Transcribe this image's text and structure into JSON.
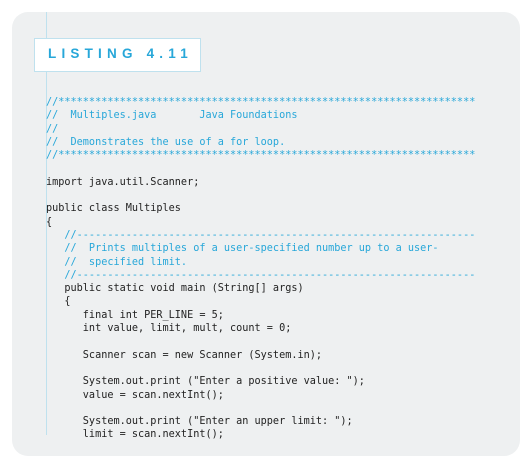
{
  "listing": {
    "title": "LISTING 4.11",
    "lines": [
      {
        "text": "//********************************************************************",
        "kind": "comment"
      },
      {
        "text": "//  Multiples.java       Java Foundations",
        "kind": "comment"
      },
      {
        "text": "//",
        "kind": "comment"
      },
      {
        "text": "//  Demonstrates the use of a for loop.",
        "kind": "comment"
      },
      {
        "text": "//********************************************************************",
        "kind": "comment"
      },
      {
        "text": "",
        "kind": "blank"
      },
      {
        "text": "import java.util.Scanner;",
        "kind": "code"
      },
      {
        "text": "",
        "kind": "blank"
      },
      {
        "text": "public class Multiples",
        "kind": "code"
      },
      {
        "text": "{",
        "kind": "code"
      },
      {
        "text": "   //-----------------------------------------------------------------",
        "kind": "comment"
      },
      {
        "text": "   //  Prints multiples of a user-specified number up to a user-",
        "kind": "comment"
      },
      {
        "text": "   //  specified limit.",
        "kind": "comment"
      },
      {
        "text": "   //-----------------------------------------------------------------",
        "kind": "comment"
      },
      {
        "text": "   public static void main (String[] args)",
        "kind": "code"
      },
      {
        "text": "   {",
        "kind": "code"
      },
      {
        "text": "      final int PER_LINE = 5;",
        "kind": "code"
      },
      {
        "text": "      int value, limit, mult, count = 0;",
        "kind": "code"
      },
      {
        "text": "",
        "kind": "blank"
      },
      {
        "text": "      Scanner scan = new Scanner (System.in);",
        "kind": "code"
      },
      {
        "text": "",
        "kind": "blank"
      },
      {
        "text": "      System.out.print (\"Enter a positive value: \");",
        "kind": "code"
      },
      {
        "text": "      value = scan.nextInt();",
        "kind": "code"
      },
      {
        "text": "",
        "kind": "blank"
      },
      {
        "text": "      System.out.print (\"Enter an upper limit: \");",
        "kind": "code"
      },
      {
        "text": "      limit = scan.nextInt();",
        "kind": "code"
      }
    ]
  }
}
